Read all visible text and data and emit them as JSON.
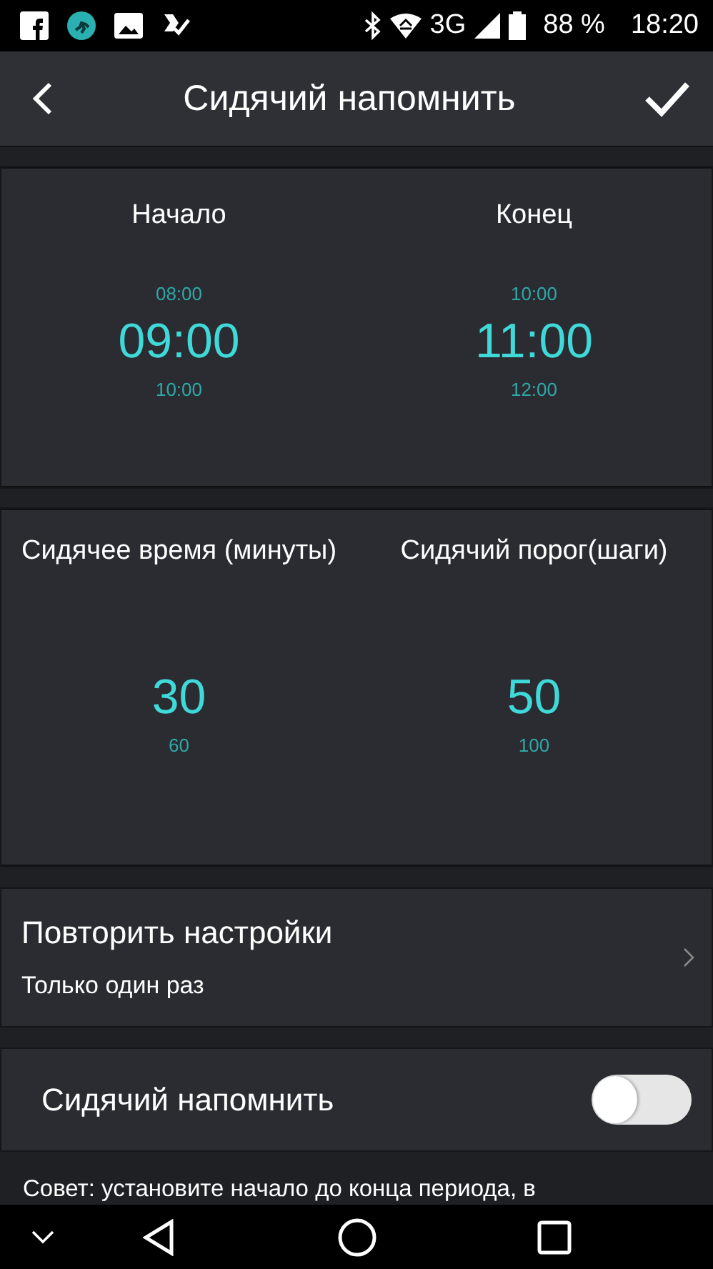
{
  "status_bar": {
    "network": "3G",
    "battery": "88 %",
    "time": "18:20"
  },
  "app_bar": {
    "title": "Сидячий напомнить"
  },
  "time_range": [
    {
      "label": "Начало",
      "above": "08:00",
      "value": "09:00",
      "below": "10:00"
    },
    {
      "label": "Конец",
      "above": "10:00",
      "value": "11:00",
      "below": "12:00"
    }
  ],
  "thresholds": [
    {
      "label": "Сидячее время (минуты)",
      "value": "30",
      "below": "60"
    },
    {
      "label": "Сидячий порог(шаги)",
      "value": "50",
      "below": "100"
    }
  ],
  "repeat": {
    "title": "Повторить настройки",
    "value": "Только один раз"
  },
  "reminder": {
    "label": "Сидячий напомнить",
    "on": false
  },
  "tip": "Совет: установите начало до конца периода, в"
}
